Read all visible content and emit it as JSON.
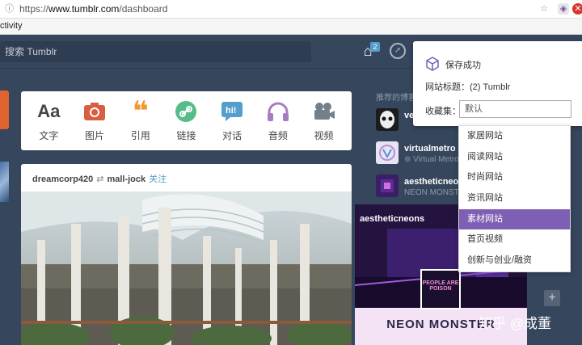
{
  "browser": {
    "url_prefix": "https://",
    "url_host": "www.tumblr.com",
    "url_path": "/dashboard",
    "bookmark_text": "ctivity"
  },
  "header": {
    "search_placeholder": "搜索 Tumblr",
    "home_badge": "2"
  },
  "post_types": [
    {
      "icon": "Aa",
      "label": "文字",
      "color": "#444444"
    },
    {
      "icon": "camera-icon",
      "label": "图片",
      "color": "#d95e40"
    },
    {
      "icon": "quote-icon",
      "label": "引用",
      "color": "#f2992e"
    },
    {
      "icon": "link-icon",
      "label": "链接",
      "color": "#56bc8a"
    },
    {
      "icon": "chat-icon",
      "label": "对话",
      "color": "#529ecc"
    },
    {
      "icon": "audio-icon",
      "label": "音频",
      "color": "#a77dc2"
    },
    {
      "icon": "video-icon",
      "label": "视频",
      "color": "#748089"
    }
  ],
  "post": {
    "author": "dreamcorp420",
    "reblog_from": "mall-jock",
    "follow_label": "关注"
  },
  "recommended": {
    "title": "推荐的博客",
    "items": [
      {
        "name": "ve",
        "sub": "",
        "avatar_color": "#1c1c1c"
      },
      {
        "name": "virtualmetro",
        "sub": "Virtual Metro",
        "avatar_color": "#e9e4f2"
      },
      {
        "name": "aestheticneons",
        "sub": "NEON MONSTER",
        "avatar_color": "#3a1e66"
      }
    ]
  },
  "radar": {
    "blog_name": "aestheticneons",
    "avatar_text": "PEOPLE ARE POISON",
    "title": "NEON MONSTER"
  },
  "popup": {
    "success": "保存成功",
    "title_label": "网站标题：",
    "title_value": "(2) Tumblr",
    "collection_label": "收藏集：",
    "collection_value": "默认"
  },
  "dropdown": {
    "options": [
      "家居网站",
      "阅读网站",
      "时尚网站",
      "资讯网站",
      "素材网站",
      "首页视频",
      "创新与创业/融资"
    ],
    "selected": "素材网站"
  },
  "watermark": "知乎 @成董"
}
